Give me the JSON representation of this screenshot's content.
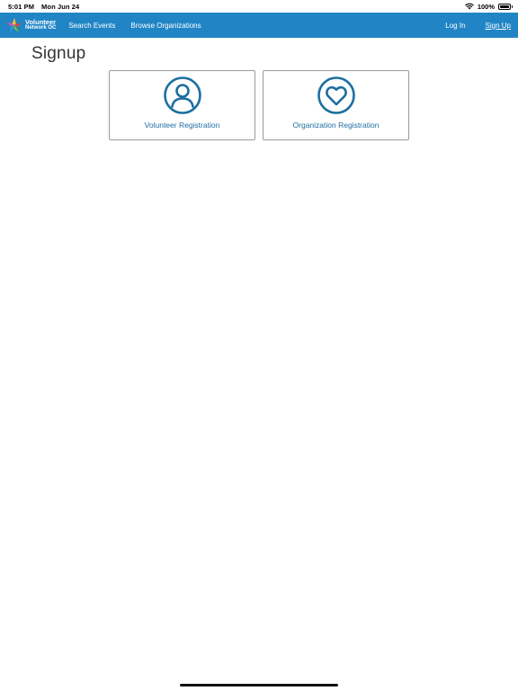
{
  "status_bar": {
    "time": "5:01 PM",
    "date": "Mon Jun 24",
    "battery": "100%"
  },
  "navbar": {
    "brand_line1": "Volunteer",
    "brand_line2": "Network OC",
    "links": [
      "Search Events",
      "Browse Organizations"
    ],
    "login": "Log In",
    "signup": "Sign Up",
    "color": "#2185c5"
  },
  "page": {
    "title": "Signup"
  },
  "cards": [
    {
      "label": "Volunteer Registration",
      "icon": "user-icon"
    },
    {
      "label": "Organization Registration",
      "icon": "heart-icon"
    }
  ],
  "colors": {
    "accent_text": "#1d6fa0",
    "icon_stroke": "#1d6fa0"
  }
}
